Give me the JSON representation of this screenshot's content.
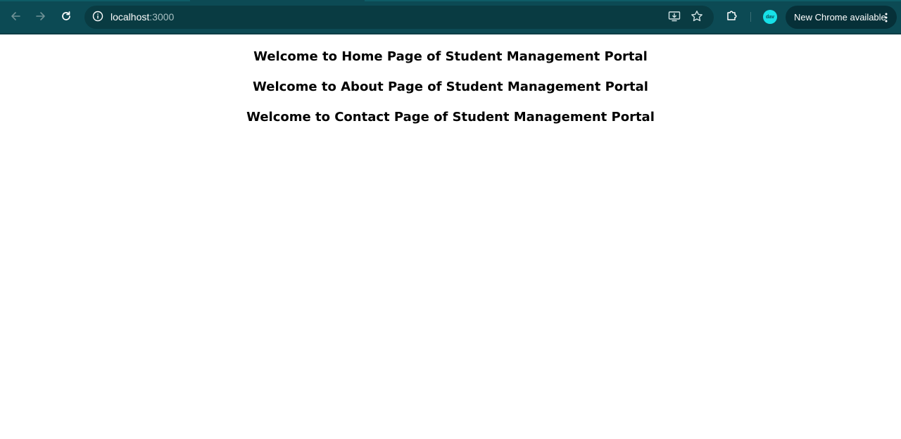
{
  "browser": {
    "url_host": "localhost",
    "url_port": ":3000",
    "update_label": "New Chrome available",
    "profile_initials": "dav",
    "icons": {
      "back": "back-arrow-icon",
      "forward": "forward-arrow-icon",
      "reload": "reload-icon",
      "site_info": "info-icon",
      "install": "install-app-icon",
      "bookmark": "star-icon",
      "extensions": "puzzle-icon",
      "menu": "kebab-menu-icon"
    },
    "colors": {
      "toolbar": "#0c4a54",
      "omnibox": "#093b42",
      "profile": "#17e0e8"
    }
  },
  "page": {
    "headings": [
      "Welcome to Home Page of Student Management Portal",
      "Welcome to About Page of Student Management Portal",
      "Welcome to Contact Page of Student Management Portal"
    ]
  }
}
